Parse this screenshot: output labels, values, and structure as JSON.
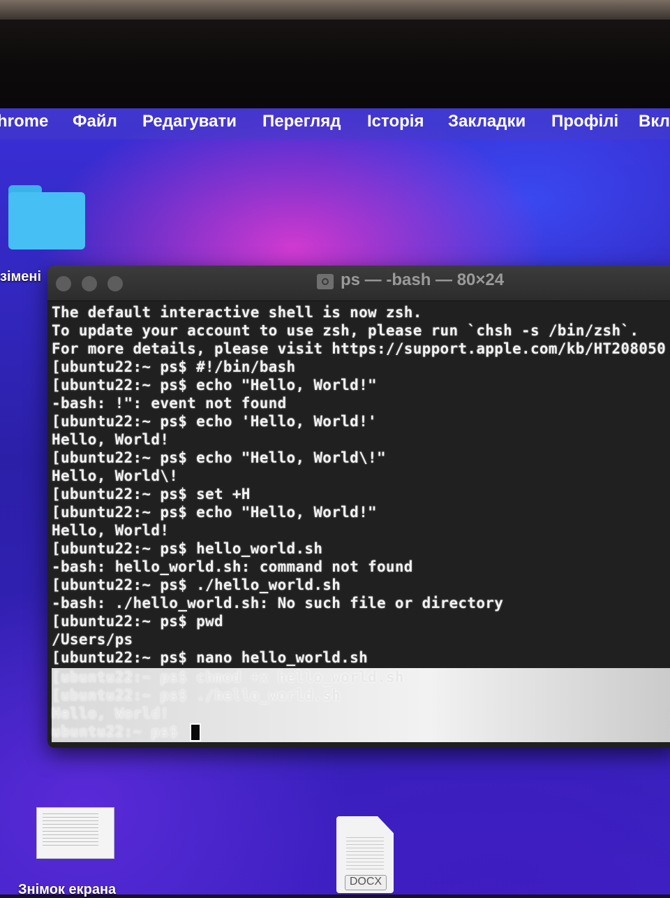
{
  "menubar": {
    "items": [
      "hrome",
      "Файл",
      "Редагувати",
      "Перегляд",
      "Історія",
      "Закладки",
      "Профілі",
      "Вкл"
    ]
  },
  "desktop": {
    "folder_label": "зімені",
    "screenshot_label": "Знімок екрана",
    "docx_label": "DOCX"
  },
  "terminal": {
    "title": "ps — -bash — 80×24",
    "lines": [
      "The default interactive shell is now zsh.",
      "To update your account to use zsh, please run `chsh -s /bin/zsh`.",
      "For more details, please visit https://support.apple.com/kb/HT208050",
      "[ubuntu22:~ ps$ #!/bin/bash",
      "[ubuntu22:~ ps$ echo \"Hello, World!\"",
      "-bash: !\": event not found",
      "[ubuntu22:~ ps$ echo 'Hello, World!'",
      "Hello, World!",
      "[ubuntu22:~ ps$ echo \"Hello, World\\!\"",
      "Hello, World\\!",
      "[ubuntu22:~ ps$ set +H",
      "[ubuntu22:~ ps$ echo \"Hello, World!\"",
      "Hello, World!",
      "[ubuntu22:~ ps$ hello_world.sh",
      "-bash: hello_world.sh: command not found",
      "[ubuntu22:~ ps$ ./hello_world.sh",
      "-bash: ./hello_world.sh: No such file or directory",
      "[ubuntu22:~ ps$ pwd",
      "/Users/ps",
      "[ubuntu22:~ ps$ nano hello_world.sh",
      "[ubuntu22:~ ps$ chmod +x hello_world.sh",
      "[ubuntu22:~ ps$ ./hello_world.sh",
      "Hello, World!",
      "ubuntu22:~ ps$ "
    ]
  }
}
